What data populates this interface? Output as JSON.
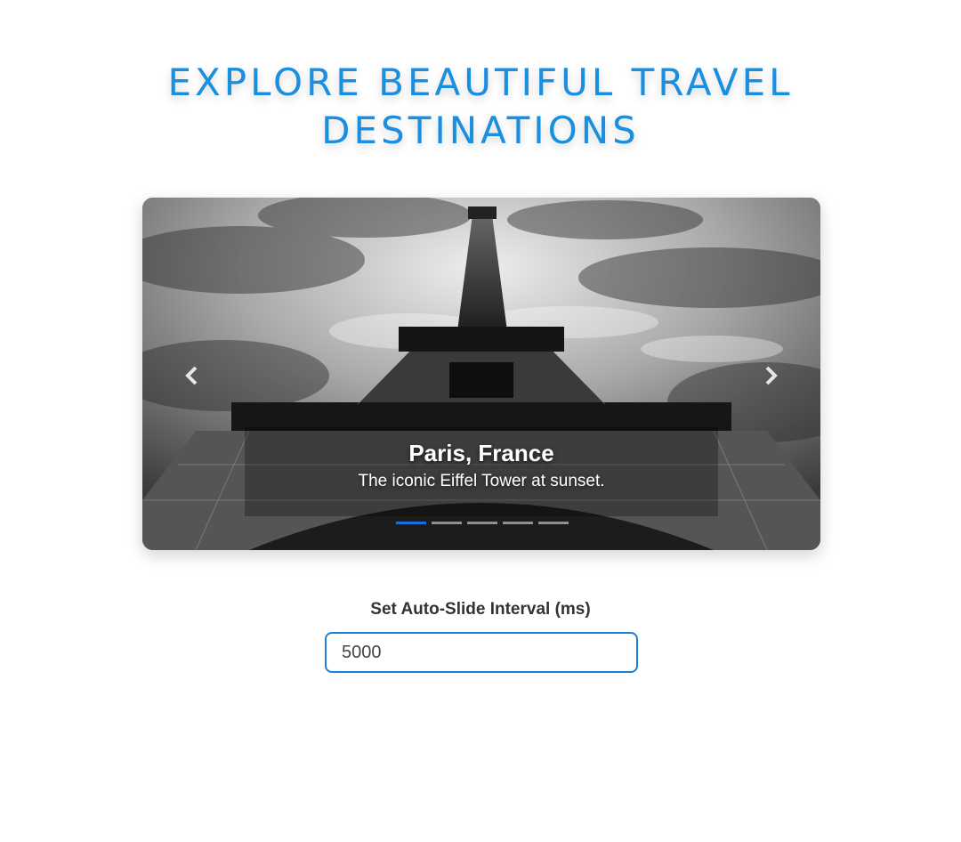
{
  "header": {
    "title_line1": "EXPLORE BEAUTIFUL TRAVEL",
    "title_line2": "DESTINATIONS",
    "color": "#1a8fe0"
  },
  "carousel": {
    "slide": {
      "title": "Paris, France",
      "description": "The iconic Eiffel Tower at sunset.",
      "image": "eiffel-tower-black-and-white"
    },
    "prev_icon": "chevron-left-icon",
    "next_icon": "chevron-right-icon",
    "slide_count": 5,
    "active_index": 0,
    "indicator_active_color": "#1a6fe0"
  },
  "interval_control": {
    "label": "Set Auto-Slide Interval (ms)",
    "value": "5000",
    "border_color": "#1a7fd6"
  }
}
